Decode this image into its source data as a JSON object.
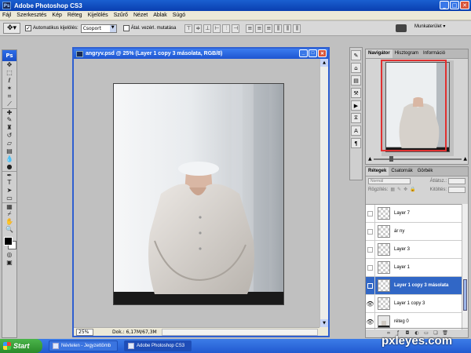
{
  "app": {
    "title": "Adobe Photoshop CS3",
    "ps_badge": "Ps"
  },
  "menu": [
    "Fájl",
    "Szerkesztés",
    "Kép",
    "Réteg",
    "Kijelölés",
    "Szűrő",
    "Nézet",
    "Ablak",
    "Súgó"
  ],
  "options": {
    "auto_select_label": "Automatikus kijelölés:",
    "auto_select_checked": true,
    "auto_select_value": "Csoport",
    "transform_label": "Átal. vezérl. mutatása",
    "transform_checked": false,
    "workspace_label": "Munkaterület"
  },
  "document": {
    "title": "angryv.psd @ 25% (Layer 1 copy 3 másolata, RGB/8)",
    "zoom": "25%",
    "doc_info": "Dok.: 6,17M/67,3M"
  },
  "navigator": {
    "tabs": [
      "Navigátor",
      "Hisztogram",
      "Információ"
    ],
    "active_tab": 0
  },
  "layers_panel": {
    "tabs": [
      "Rétegek",
      "Csatornák",
      "Görbék"
    ],
    "active_tab": 0,
    "blend_mode": "Normál",
    "opacity_label": "Átlátsz.:",
    "lock_label": "Rögzítés:",
    "fill_label": "Kitöltés:",
    "layers": [
      {
        "name": "Layer 7",
        "visible": false,
        "selected": false,
        "thumb": "transparent"
      },
      {
        "name": "ár ny",
        "visible": false,
        "selected": false,
        "thumb": "transparent"
      },
      {
        "name": "Layer 3",
        "visible": false,
        "selected": false,
        "thumb": "transparent"
      },
      {
        "name": "Layer 1",
        "visible": false,
        "selected": false,
        "thumb": "transparent"
      },
      {
        "name": "Layer 1 copy 3 másolata",
        "visible": false,
        "selected": true,
        "thumb": "transparent"
      },
      {
        "name": "Layer 1 copy 3",
        "visible": true,
        "selected": false,
        "thumb": "transparent"
      },
      {
        "name": "réteg 0",
        "visible": true,
        "selected": false,
        "thumb": "photo"
      }
    ]
  },
  "taskbar": {
    "start_label": "Start",
    "tasks": [
      {
        "label": "Névtelen - Jegyzettömb",
        "active": false
      },
      {
        "label": "Adobe Photoshop CS3",
        "active": true
      }
    ]
  },
  "watermark": "pxleyes.com"
}
